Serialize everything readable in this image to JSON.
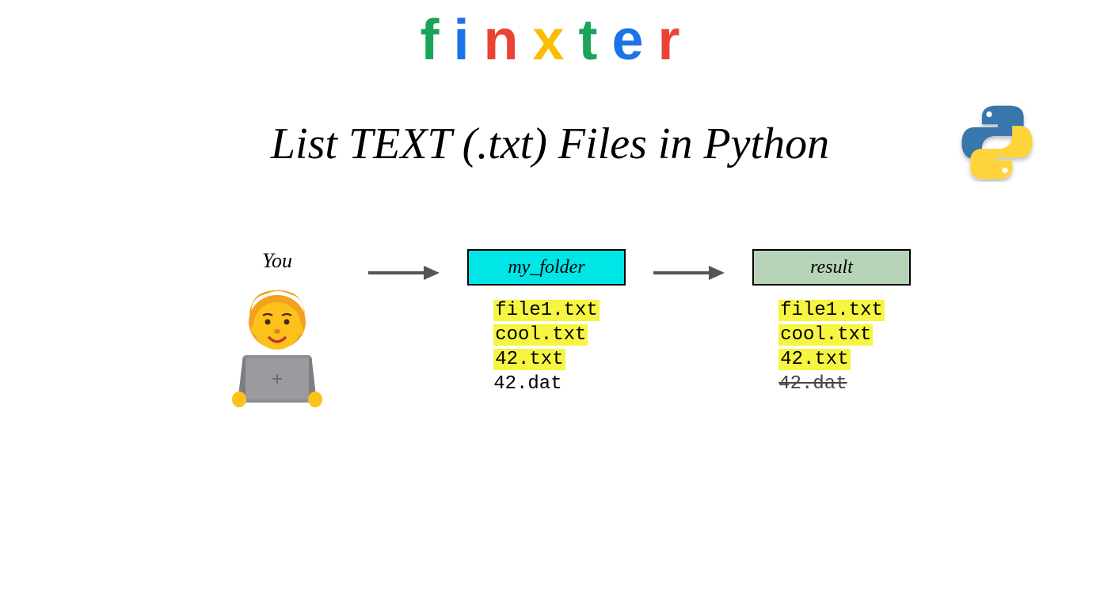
{
  "logo": {
    "letters": [
      "f",
      "i",
      "n",
      "x",
      "t",
      "e",
      "r"
    ]
  },
  "title": "List TEXT (.txt) Files in Python",
  "diagram": {
    "you_label": "You",
    "folder_box": "my_folder",
    "result_box": "result",
    "folder_files": [
      {
        "name": "file1.txt",
        "highlight": true,
        "strike": false
      },
      {
        "name": "cool.txt",
        "highlight": true,
        "strike": false
      },
      {
        "name": "42.txt",
        "highlight": true,
        "strike": false
      },
      {
        "name": "42.dat",
        "highlight": false,
        "strike": false
      }
    ],
    "result_files": [
      {
        "name": "file1.txt",
        "highlight": true,
        "strike": false
      },
      {
        "name": "cool.txt",
        "highlight": true,
        "strike": false
      },
      {
        "name": "42.txt",
        "highlight": true,
        "strike": false
      },
      {
        "name": "42.dat",
        "highlight": false,
        "strike": true
      }
    ]
  }
}
